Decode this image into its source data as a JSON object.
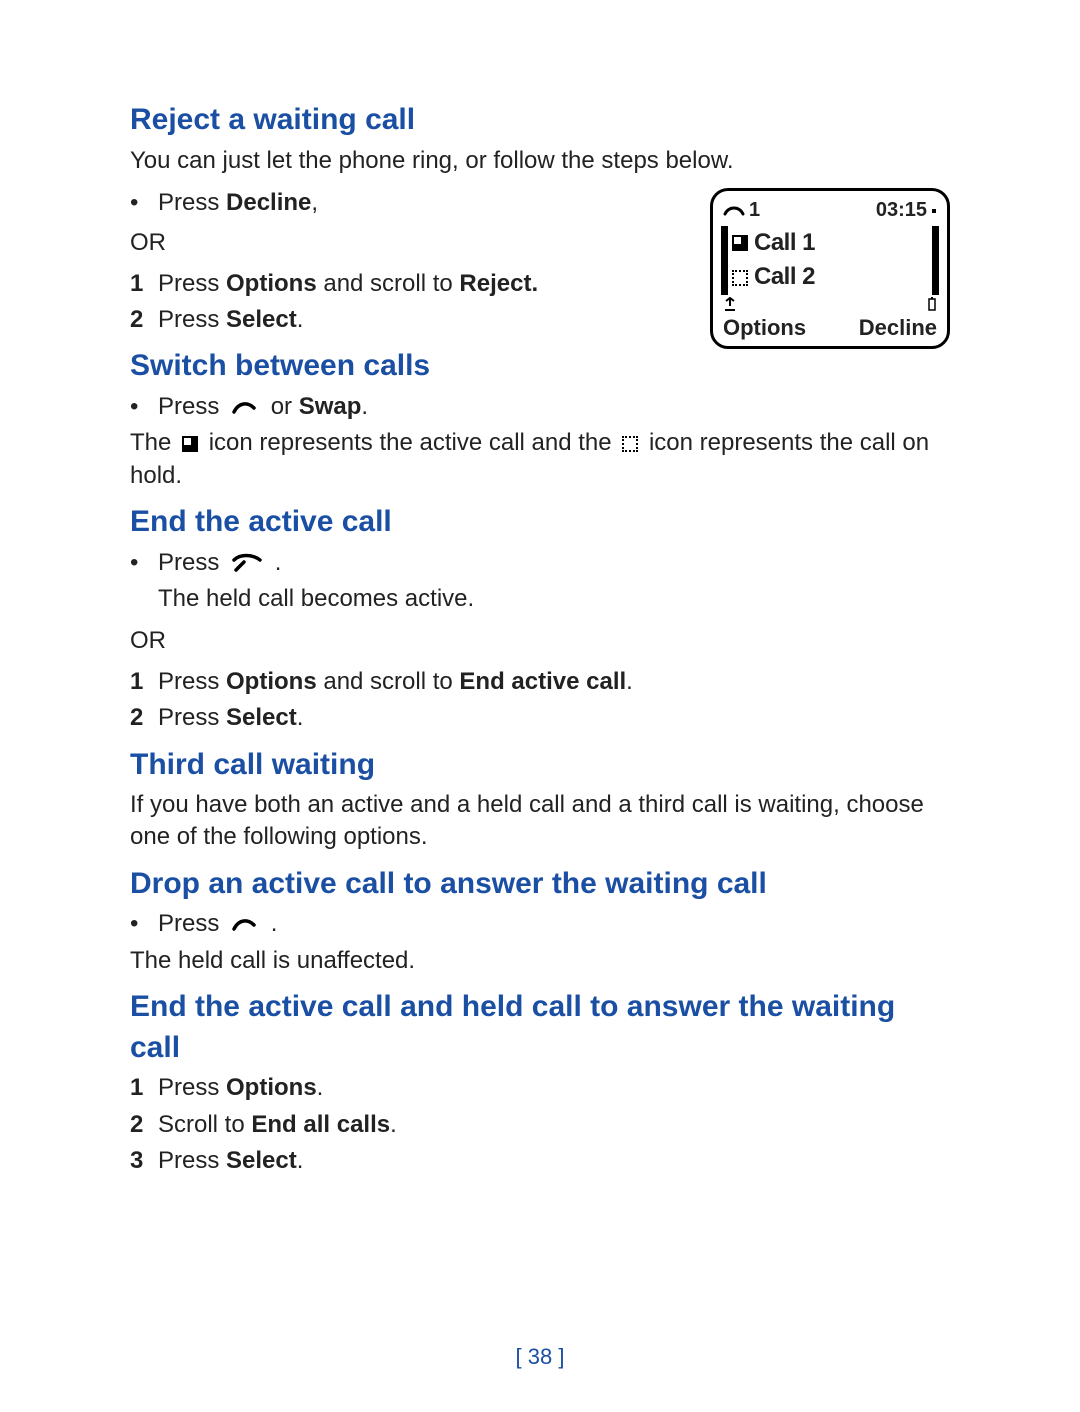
{
  "page_number": "[ 38 ]",
  "reject": {
    "heading": "Reject a waiting call",
    "intro": "You can just let the phone ring, or follow the steps below.",
    "b1_pre": "Press ",
    "b1_bold": "Decline",
    "b1_post": ",",
    "or": "OR",
    "s1_pre": "Press ",
    "s1_b1": "Options",
    "s1_mid": " and scroll to ",
    "s1_b2": "Reject.",
    "s2_pre": "Press ",
    "s2_b": "Select",
    "s2_post": "."
  },
  "switch": {
    "heading": "Switch between calls",
    "b1_pre": "Press  ",
    "b1_mid": "  or ",
    "b1_b": "Swap",
    "b1_post": ".",
    "desc_pre": "The ",
    "desc_mid": " icon represents the active call and the ",
    "desc_post": " icon represents the call on hold."
  },
  "end_active": {
    "heading": "End the active call",
    "b1_pre": "Press  ",
    "b1_post": " .",
    "result": "The held call becomes active.",
    "or": "OR",
    "s1_pre": "Press ",
    "s1_b1": "Options",
    "s1_mid": " and scroll to ",
    "s1_b2": "End active call",
    "s1_post": ".",
    "s2_pre": "Press ",
    "s2_b": "Select",
    "s2_post": "."
  },
  "third": {
    "heading": "Third call waiting",
    "intro": "If you have both an active and a held call and a third call is waiting, choose one of the following options."
  },
  "drop": {
    "heading": "Drop an active call to answer the waiting call",
    "b1_pre": "Press  ",
    "b1_post": " .",
    "result": "The held call is unaffected."
  },
  "end_all": {
    "heading": "End the active call and held call to answer the waiting call",
    "s1_pre": "Press ",
    "s1_b": "Options",
    "s1_post": ".",
    "s2_pre": "Scroll to ",
    "s2_b": "End all calls",
    "s2_post": ".",
    "s3_pre": "Press ",
    "s3_b": "Select",
    "s3_post": "."
  },
  "phone": {
    "time": "03:15",
    "call1": "Call 1",
    "call2": "Call 2",
    "left_soft": "Options",
    "right_soft": "Decline",
    "top_num": "1"
  },
  "nums": {
    "one": "1",
    "two": "2",
    "three": "3"
  },
  "bullet": "•"
}
